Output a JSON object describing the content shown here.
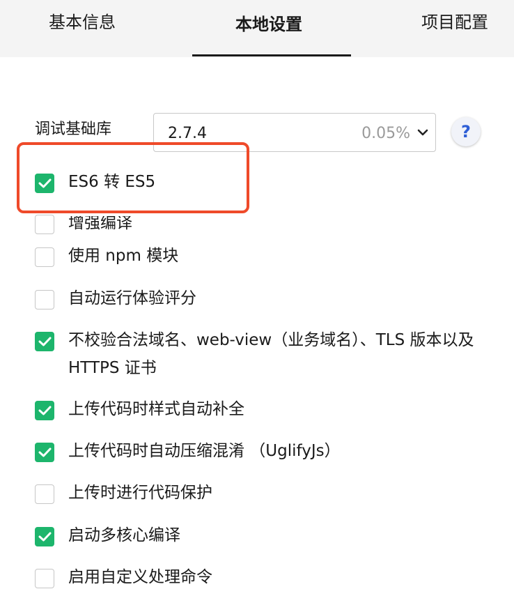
{
  "tabs": [
    {
      "label": "基本信息",
      "active": false
    },
    {
      "label": "本地设置",
      "active": true
    },
    {
      "label": "项目配置",
      "active": false
    }
  ],
  "base_library": {
    "label": "调试基础库",
    "version": "2.7.4",
    "usage": "0.05%",
    "help": "?"
  },
  "options": [
    {
      "label": "ES6 转 ES5",
      "checked": true
    },
    {
      "label": "增强编译",
      "checked": false
    },
    {
      "label": "使用 npm 模块",
      "checked": false
    },
    {
      "label": "自动运行体验评分",
      "checked": false
    },
    {
      "label": "不校验合法域名、web-view（业务域名）、TLS 版本以及 HTTPS 证书",
      "checked": true
    },
    {
      "label": "上传代码时样式自动补全",
      "checked": true
    },
    {
      "label": "上传代码时自动压缩混淆 （UglifyJs）",
      "checked": true
    },
    {
      "label": "上传时进行代码保护",
      "checked": false
    },
    {
      "label": "启动多核心编译",
      "checked": true
    },
    {
      "label": "启用自定义处理命令",
      "checked": false
    }
  ],
  "colors": {
    "check_green": "#1db56c",
    "highlight_red": "#ef4a2a",
    "help_blue": "#2f5fd6"
  }
}
